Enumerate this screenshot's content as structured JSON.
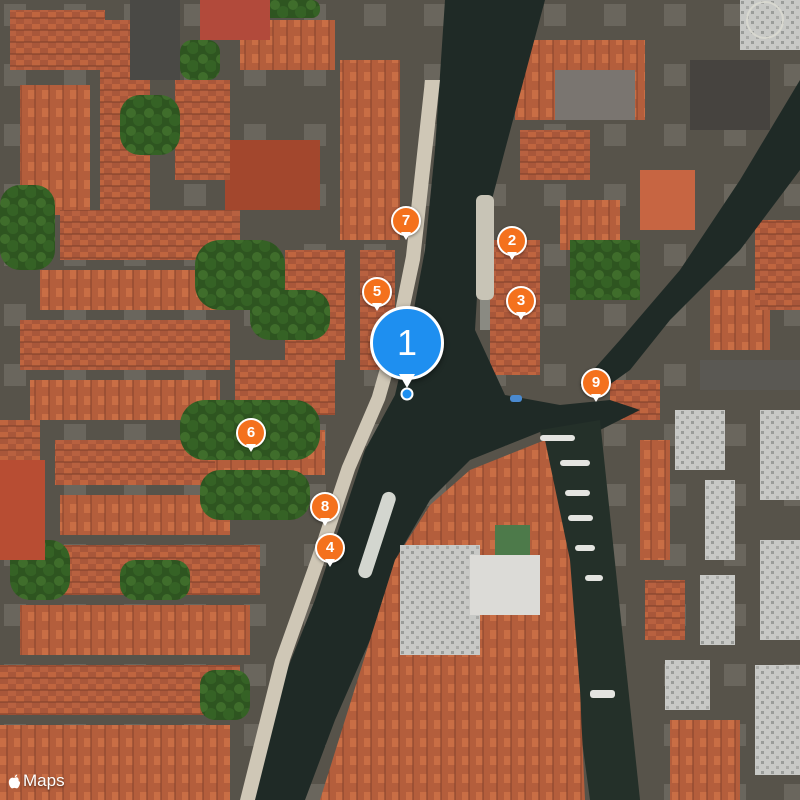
{
  "map": {
    "type": "satellite",
    "attribution": {
      "brand_icon": "apple-logo-icon",
      "label": "Maps"
    },
    "colors": {
      "water": "#1f2a26",
      "pin_primary": "#1e8ff0",
      "pin_secondary": "#f4711d",
      "roof": "#b4593a",
      "trees": "#2f5a22"
    },
    "pins": [
      {
        "label": "1",
        "kind": "primary"
      },
      {
        "label": "2",
        "kind": "secondary"
      },
      {
        "label": "3",
        "kind": "secondary"
      },
      {
        "label": "4",
        "kind": "secondary"
      },
      {
        "label": "5",
        "kind": "secondary"
      },
      {
        "label": "6",
        "kind": "secondary"
      },
      {
        "label": "7",
        "kind": "secondary"
      },
      {
        "label": "8",
        "kind": "secondary"
      },
      {
        "label": "9",
        "kind": "secondary"
      }
    ]
  }
}
